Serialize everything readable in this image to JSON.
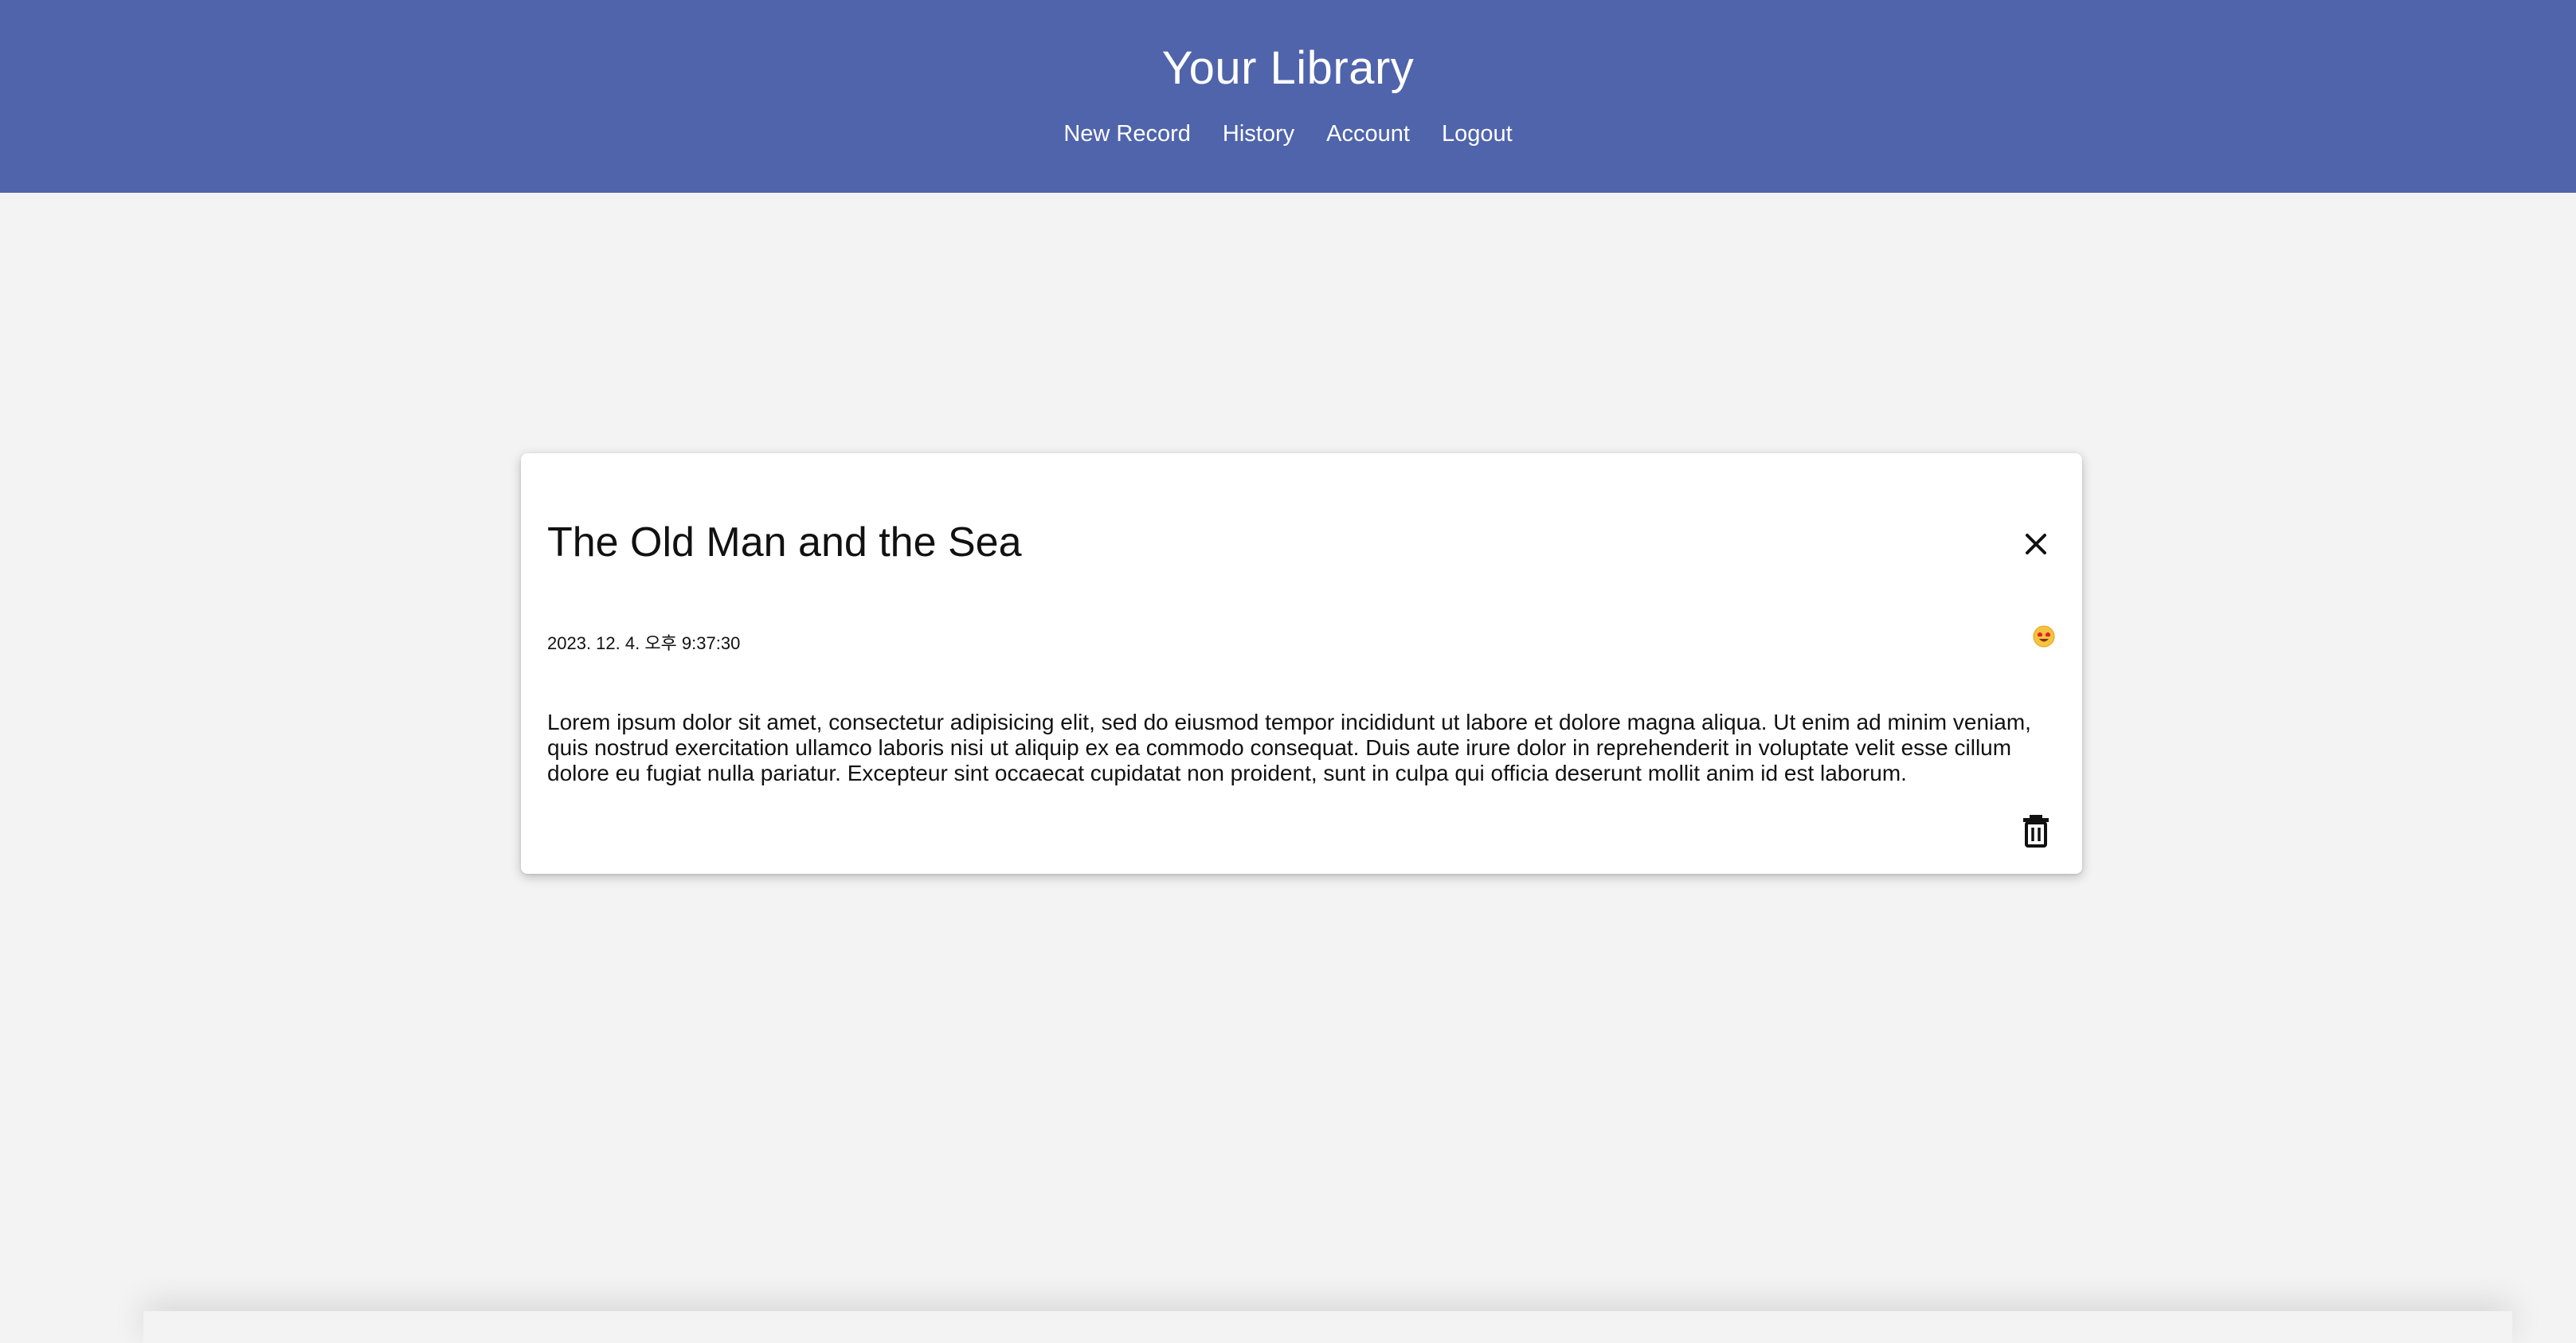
{
  "header": {
    "title": "Your Library",
    "background": "#5064ab",
    "nav": [
      {
        "label": "New Record"
      },
      {
        "label": "History"
      },
      {
        "label": "Account"
      },
      {
        "label": "Logout"
      }
    ]
  },
  "record": {
    "title": "The Old Man and the Sea",
    "timestamp": "2023. 12. 4. 오후 9:37:30",
    "mood_icon": "heart-eyes-emoji-icon",
    "body": "Lorem ipsum dolor sit amet, consectetur adipisicing elit, sed do eiusmod tempor incididunt ut labore et dolore magna aliqua. Ut enim ad minim veniam, quis nostrud exercitation ullamco laboris nisi ut aliquip ex ea commodo consequat. Duis aute irure dolor in reprehenderit in voluptate velit esse cillum dolore eu fugiat nulla pariatur. Excepteur sint occaecat cupidatat non proident, sunt in culpa qui officia deserunt mollit anim id est laborum.",
    "close_icon": "close-icon",
    "delete_icon": "trash-icon"
  }
}
